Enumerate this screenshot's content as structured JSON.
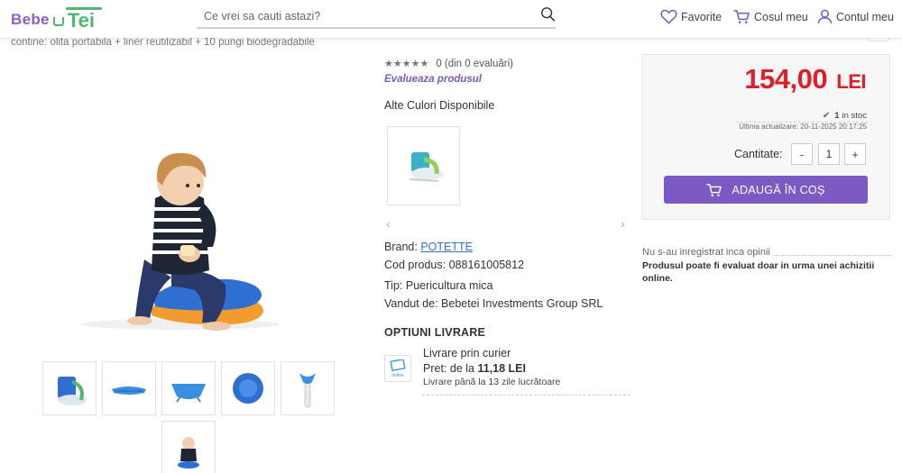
{
  "header": {
    "logo_left": "Bebe",
    "logo_right": "Tei",
    "search_placeholder": "Ce vrei sa cauti astazi?",
    "favorites": "Favorite",
    "cart": "Cosul meu",
    "account": "Contul meu"
  },
  "product": {
    "subtitle": "contine: olita portabila + liner reutilizabil + 10 pungi biodegradabile",
    "rating_text": "0 (din 0 evaluări)",
    "stars": "★★★★★",
    "evaluate_link": "Evalueaza produsul",
    "alt_colors": "Alte Culori Disponibile",
    "brand_label": "Brand:",
    "brand": "POTETTE",
    "code_label": "Cod produs:",
    "code": "088161005812",
    "type_label": "Tip:",
    "type": "Puericultura mica",
    "seller_label": "Vandut de:",
    "seller": "Bebetei Investments Group SRL"
  },
  "delivery": {
    "title": "OPTIUNI LIVRARE",
    "courier_name": "Livrare prin curier",
    "price_label": "Pret: de la",
    "price": "11,18 LEI",
    "time": "Livrare până la 13 zile lucrătoare",
    "icon_label": "online"
  },
  "buy_panel": {
    "price": "154,00",
    "currency": "LEI",
    "stock_count": "1",
    "stock_text": "in stoc",
    "updated": "Ultima actualizare: 20-11-2025 20:17:25",
    "qty_label": "Cantitate:",
    "qty_value": "1",
    "minus": "-",
    "plus": "+",
    "add_to_cart": "ADAUGĂ ÎN COȘ"
  },
  "reviews": {
    "none": "Nu s-au inregistrat inca opinii",
    "note": "Produsul poate fi evaluat doar in urma unei achizitii online."
  },
  "colors": {
    "accent": "#7c5ac4",
    "price": "#e01f2a",
    "brand_green": "#4eb96f",
    "link": "#3a6fc0"
  }
}
